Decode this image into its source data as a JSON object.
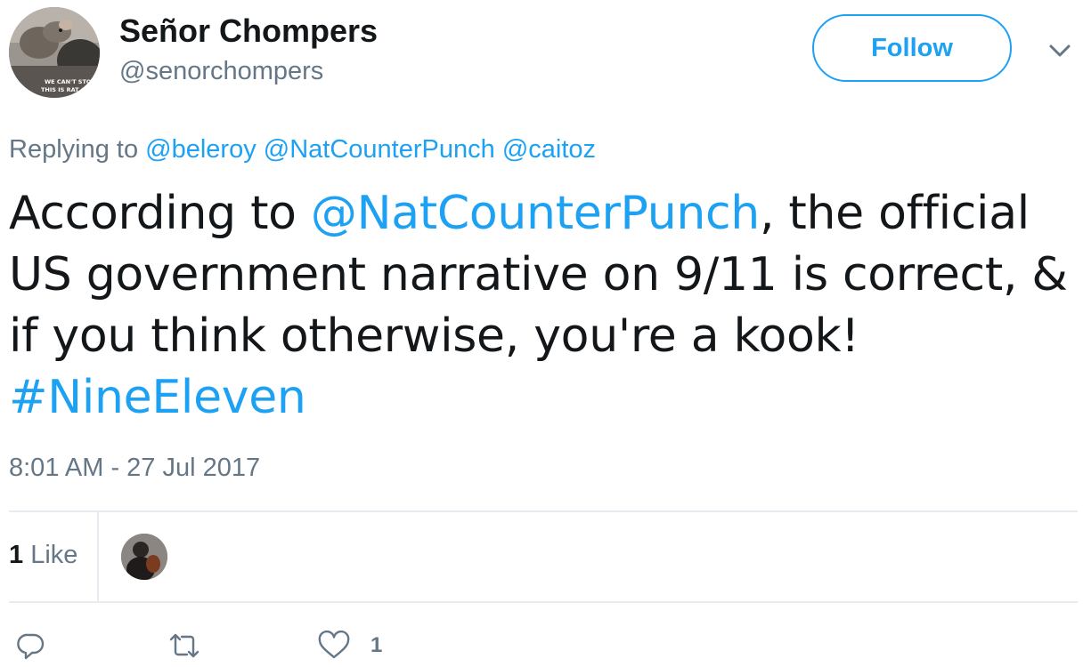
{
  "author": {
    "display_name": "Señor Chompers",
    "handle": "@senorchompers",
    "avatar_caption_lines": [
      "WE CAN'T STOP HIM",
      "THIS IS RAT COUNTRY"
    ]
  },
  "follow_button": {
    "label": "Follow"
  },
  "replying_to": {
    "prefix": "Replying to",
    "mentions": [
      "@beleroy",
      "@NatCounterPunch",
      "@caitoz"
    ]
  },
  "tweet": {
    "text_before": "According to ",
    "mention": "@NatCounterPunch",
    "text_after": ", the official US government narrative on 9/11 is correct, & if you think otherwise, you're a kook!",
    "hashtag": "#NineEleven"
  },
  "timestamp": "8:01 AM - 27 Jul 2017",
  "stats": {
    "likes_number": "1",
    "likes_label": "Like"
  },
  "actions": {
    "like_count": "1"
  },
  "colors": {
    "link": "#1da1f2",
    "text": "#14171a",
    "muted": "#657786",
    "divider": "#e6ecf0"
  },
  "icons": {
    "reply": "reply-icon",
    "retweet": "retweet-icon",
    "like": "heart-icon",
    "more": "chevron-down-icon"
  }
}
